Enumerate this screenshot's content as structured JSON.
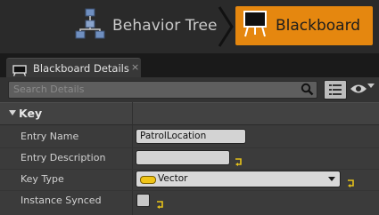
{
  "modes": {
    "behavior_tree_label": "Behavior Tree",
    "blackboard_label": "Blackboard",
    "accent_color": "#e5870f"
  },
  "tab": {
    "label": "Blackboard Details",
    "close_glyph": "×"
  },
  "search": {
    "placeholder": "Search Details"
  },
  "category": {
    "label": "Key"
  },
  "properties": [
    {
      "name": "Entry Name",
      "value": "PatrolLocation"
    },
    {
      "name": "Entry Description",
      "value": ""
    },
    {
      "name": "Key Type",
      "value": "Vector"
    },
    {
      "name": "Instance Synced",
      "checked": false
    }
  ]
}
